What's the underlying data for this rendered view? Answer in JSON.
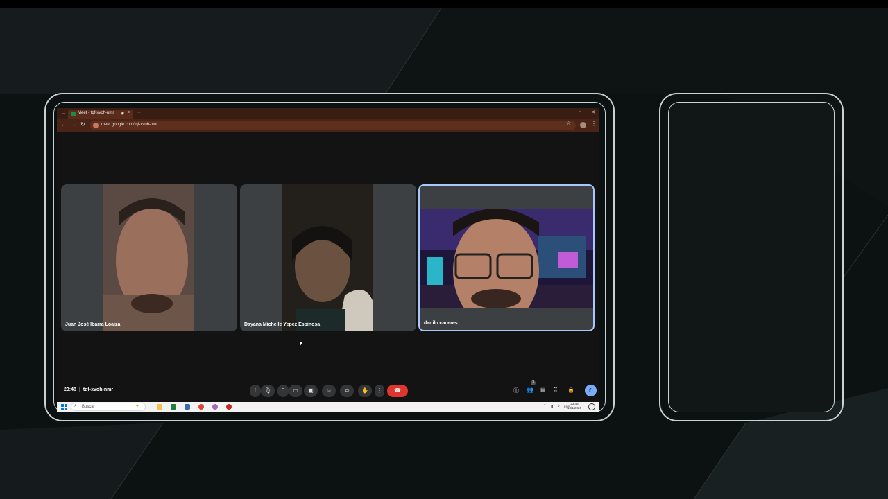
{
  "browser": {
    "tab_title": "Meet - tqf-xvoh-nmr",
    "url": "meet.google.com/tqf-xvoh-nmr"
  },
  "participants": [
    {
      "name": "Juan José Ibarra Loaiza"
    },
    {
      "name": "Dayana Michelle Yepez Espinosa"
    },
    {
      "name": "danilo caceres"
    }
  ],
  "meeting": {
    "time": "23:48",
    "separator": "|",
    "code": "tqf-xvoh-nmr",
    "people_count": "3"
  },
  "taskbar": {
    "search_placeholder": "Buscar",
    "tray_lang": "ESP",
    "clock_time": "23:48",
    "clock_date": "13/1/2026"
  },
  "colors": {
    "hangup": "#dc362e",
    "active_tile_border": "#a8c7fa",
    "tab_bar": "#3a1d12"
  }
}
